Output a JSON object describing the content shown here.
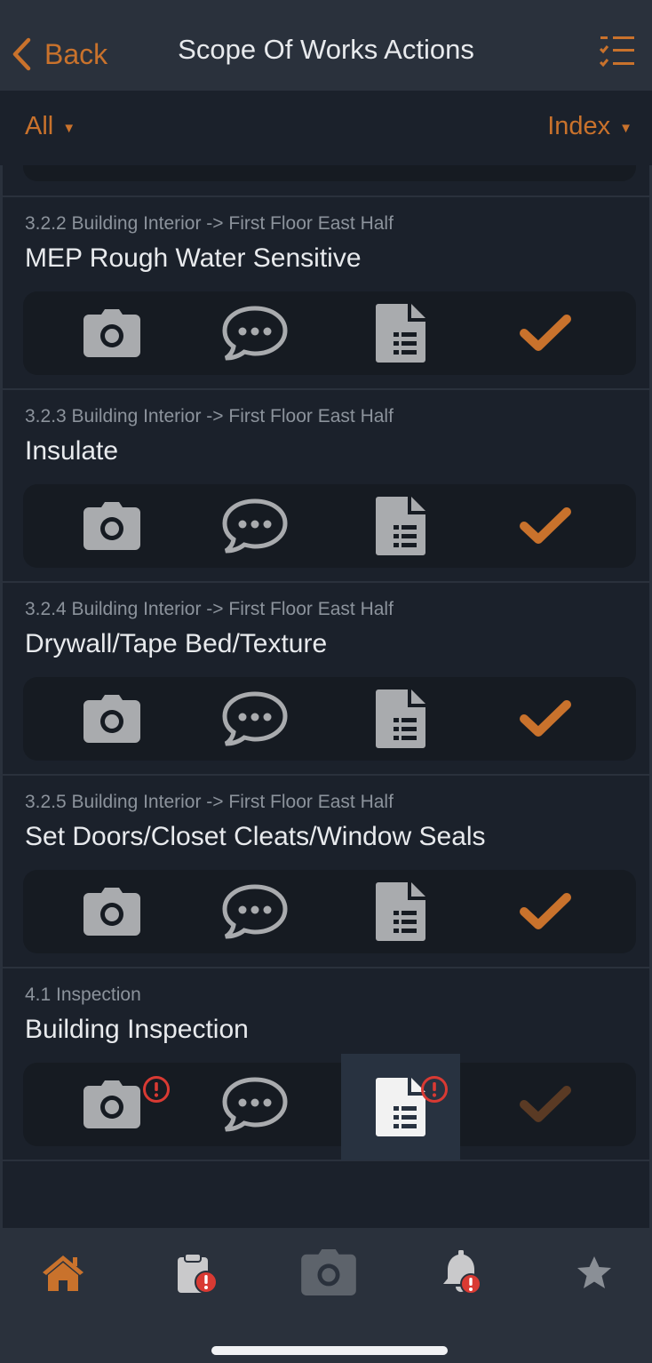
{
  "header": {
    "back_label": "Back",
    "title": "Scope Of Works Actions",
    "icon": "checklist-icon"
  },
  "filters": {
    "left": "All",
    "right": "Index"
  },
  "items": [
    {
      "crumb": "3.2.2 Building Interior -> First Floor East Half",
      "name": "MEP Rough Water Sensitive"
    },
    {
      "crumb": "3.2.3 Building Interior -> First Floor East Half",
      "name": "Insulate"
    },
    {
      "crumb": "3.2.4 Building Interior -> First Floor East Half",
      "name": "Drywall/Tape Bed/Texture"
    },
    {
      "crumb": "3.2.5 Building Interior -> First Floor East Half",
      "name": "Set Doors/Closet Cleats/Window Seals"
    },
    {
      "crumb": "4.1 Inspection",
      "name": "Building Inspection"
    }
  ],
  "action_icons": [
    "camera-icon",
    "comment-icon",
    "document-list-icon",
    "checkmark-icon"
  ],
  "tabbar": [
    "home-icon",
    "clipboard-icon",
    "camera-icon",
    "bell-icon",
    "star-icon"
  ],
  "colors": {
    "accent": "#c9722c",
    "accent_dim": "#5a3a24",
    "alert": "#d93a33",
    "icon_gray": "#a9abae",
    "background": "#1b212b",
    "bar": "#2a313c"
  }
}
